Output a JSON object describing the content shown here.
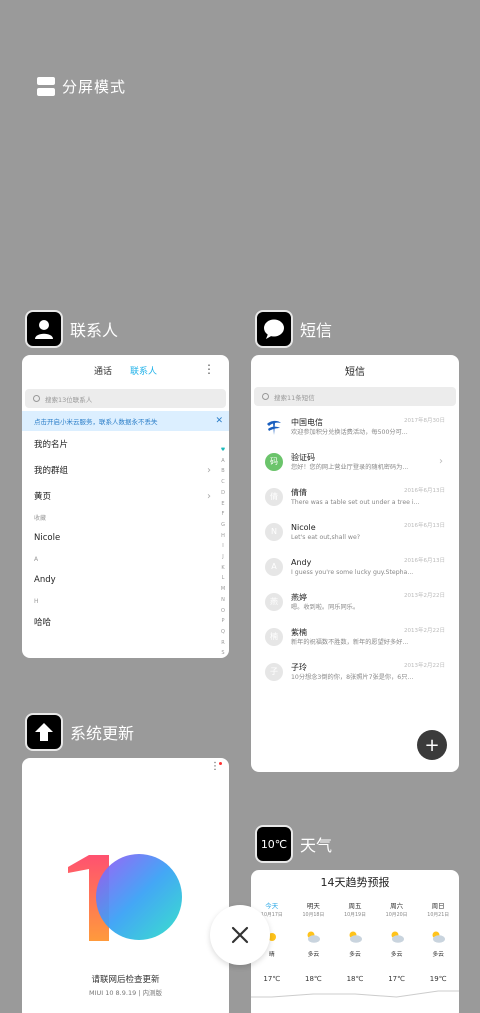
{
  "split_screen": {
    "label": "分屏模式"
  },
  "contacts": {
    "app_name": "联系人",
    "tabs": [
      "通话",
      "联系人"
    ],
    "search_placeholder": "搜索13位联系人",
    "banner": "点击开启小米云服务，联系人数据永不丢失",
    "rows": [
      {
        "type": "row",
        "label": "我的名片",
        "chev": false
      },
      {
        "type": "row",
        "label": "我的群组",
        "chev": true
      },
      {
        "type": "row",
        "label": "黄页",
        "chev": true
      },
      {
        "type": "sec",
        "label": "收藏"
      },
      {
        "type": "row",
        "label": "Nicole",
        "chev": false
      },
      {
        "type": "sec",
        "label": "A"
      },
      {
        "type": "row",
        "label": "Andy",
        "chev": false
      },
      {
        "type": "sec",
        "label": "H"
      },
      {
        "type": "row",
        "label": "哈哈",
        "chev": false
      }
    ],
    "index": [
      "#",
      "A",
      "B",
      "C",
      "D",
      "E",
      "F",
      "G",
      "H",
      "I",
      "J",
      "K",
      "L",
      "M",
      "N",
      "O",
      "P",
      "Q",
      "R",
      "S"
    ]
  },
  "messages": {
    "app_name": "短信",
    "title": "短信",
    "search_placeholder": "搜索11条短信",
    "items": [
      {
        "avatar": "telecom",
        "name": "中国电信",
        "snippet": "欢迎参加积分兑换话费活动，每500分可...",
        "date": "2017年8月30日"
      },
      {
        "avatar": "码",
        "name": "验证码",
        "snippet": "您好！您的网上营业厅登录的随机密码为...",
        "date": ""
      },
      {
        "avatar": "倩",
        "name": "倩倩",
        "snippet": "There was a table set out under a tree i...",
        "date": "2016年6月13日"
      },
      {
        "avatar": "N",
        "name": "Nicole",
        "snippet": "Let's eat out,shall we?",
        "date": "2016年6月13日"
      },
      {
        "avatar": "A",
        "name": "Andy",
        "snippet": "I guess you're some lucky guy.Stepha...",
        "date": "2016年6月13日"
      },
      {
        "avatar": "燕",
        "name": "燕婷",
        "snippet": "嗯。收到啦。同乐同乐。",
        "date": "2013年2月22日"
      },
      {
        "avatar": "楠",
        "name": "紫楠",
        "snippet": "新年的祝福数不胜数，新年的愿望好多好...",
        "date": "2013年2月22日"
      },
      {
        "avatar": "子",
        "name": "子玲",
        "snippet": "10分想念3倒的你，8张照片7张是你，6只...",
        "date": "2013年2月22日"
      }
    ]
  },
  "update": {
    "app_name": "系统更新",
    "message": "请联网后检查更新",
    "version": "MIUI 10 8.9.19 | 内测版"
  },
  "weather": {
    "app_name": "天气",
    "icon_text": "10℃",
    "title": "14天趋势预报",
    "days": [
      {
        "name": "今天",
        "date": "10月17日",
        "cond": "晴",
        "temp": "17℃",
        "icon": "sun"
      },
      {
        "name": "明天",
        "date": "10月18日",
        "cond": "多云",
        "temp": "18℃",
        "icon": "cloud"
      },
      {
        "name": "周五",
        "date": "10月19日",
        "cond": "多云",
        "temp": "18℃",
        "icon": "cloud"
      },
      {
        "name": "周六",
        "date": "10月20日",
        "cond": "多云",
        "temp": "17℃",
        "icon": "cloud"
      },
      {
        "name": "周日",
        "date": "10月21日",
        "cond": "多云",
        "temp": "19℃",
        "icon": "cloud"
      }
    ]
  },
  "colors": {
    "accent": "#1eb1e9",
    "background": "#9a9a9a"
  }
}
